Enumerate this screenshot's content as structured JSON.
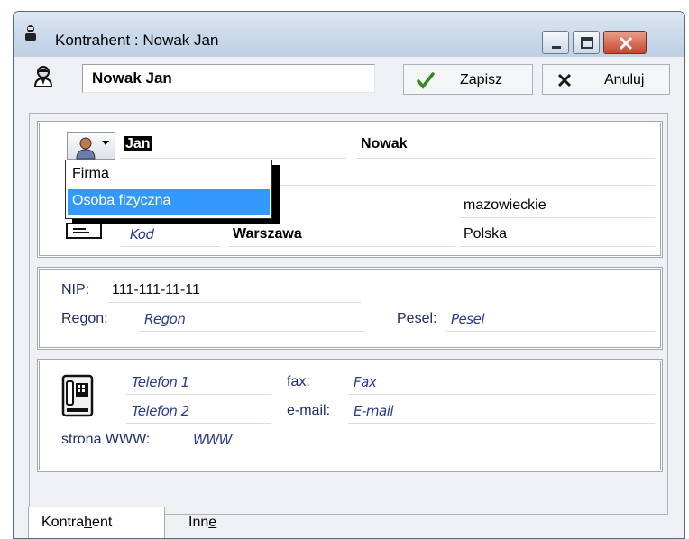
{
  "window": {
    "title": "Kontrahent : Nowak Jan"
  },
  "toolbar": {
    "name_value": "Nowak Jan",
    "save_label": "Zapisz",
    "cancel_label": "Anuluj"
  },
  "identity": {
    "first_name": "Jan",
    "last_name": "Nowak",
    "type_dropdown": {
      "options": [
        "Firma",
        "Osoba fizyczna"
      ],
      "highlighted": "Osoba fizyczna"
    },
    "region": "mazowieckie",
    "postal_code_placeholder": "Kod",
    "city": "Warszawa",
    "country": "Polska"
  },
  "tax": {
    "nip_label": "NIP:",
    "nip_value": "111-111-11-11",
    "regon_label": "Regon:",
    "regon_placeholder": "Regon",
    "pesel_label": "Pesel:",
    "pesel_placeholder": "Pesel"
  },
  "contact": {
    "phone1_placeholder": "Telefon 1",
    "phone2_placeholder": "Telefon 2",
    "fax_label": "fax:",
    "fax_placeholder": "Fax",
    "email_label": "e-mail:",
    "email_placeholder": "E-mail",
    "www_label": "strona WWW:",
    "www_placeholder": "WWW"
  },
  "tabs": [
    {
      "pre": "Kontra",
      "u": "h",
      "post": "ent"
    },
    {
      "pre": "Inn",
      "u": "e",
      "post": ""
    }
  ],
  "colors": {
    "selection": "#3399ff",
    "placeholder": "#2a3a8c",
    "save_check": "#2f8a1a",
    "cancel_x": "#1a1a1a"
  },
  "icons": [
    "app-icon",
    "person-icon",
    "checkmark-icon",
    "close-x-icon",
    "person-type-icon",
    "address-card-icon",
    "phone-icon"
  ]
}
